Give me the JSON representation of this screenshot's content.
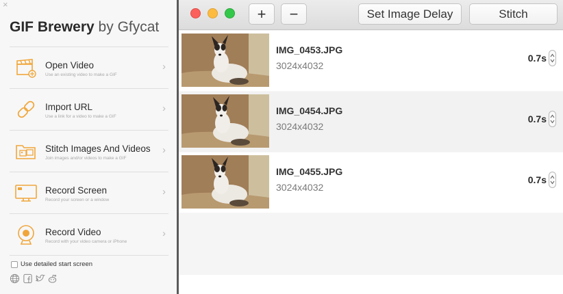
{
  "left_panel": {
    "close_glyph": "×",
    "title_bold": "GIF Brewery",
    "title_light": " by Gfycat",
    "menu": [
      {
        "title": "Open Video",
        "subtitle": "Use an existing video to make a GIF",
        "icon": "clapperboard-icon"
      },
      {
        "title": "Import URL",
        "subtitle": "Use a link for a video to make a GIF",
        "icon": "link-icon"
      },
      {
        "title": "Stitch Images And Videos",
        "subtitle": "Join images and/or videos to make a GIF",
        "icon": "folder-images-icon"
      },
      {
        "title": "Record Screen",
        "subtitle": "Record your screen or a window",
        "icon": "monitor-icon"
      },
      {
        "title": "Record Video",
        "subtitle": "Record with your video camera or iPhone",
        "icon": "webcam-icon"
      }
    ],
    "chevron": "›",
    "detail_checkbox_label": "Use detailed start screen",
    "social_icons": [
      "globe-icon",
      "facebook-icon",
      "twitter-icon",
      "reddit-icon"
    ],
    "accent_color": "#f0a63a"
  },
  "toolbar": {
    "window_controls": [
      "close",
      "minimize",
      "zoom"
    ],
    "control_colors": [
      "#fc605c",
      "#fdbc40",
      "#34c84a"
    ],
    "add_label": "+",
    "remove_label": "−",
    "set_delay_label": "Set Image Delay",
    "stitch_label": "Stitch"
  },
  "images": [
    {
      "filename": "IMG_0453.JPG",
      "dimensions": "3024x4032",
      "delay": "0.7s"
    },
    {
      "filename": "IMG_0454.JPG",
      "dimensions": "3024x4032",
      "delay": "0.7s"
    },
    {
      "filename": "IMG_0455.JPG",
      "dimensions": "3024x4032",
      "delay": "0.7s"
    }
  ]
}
